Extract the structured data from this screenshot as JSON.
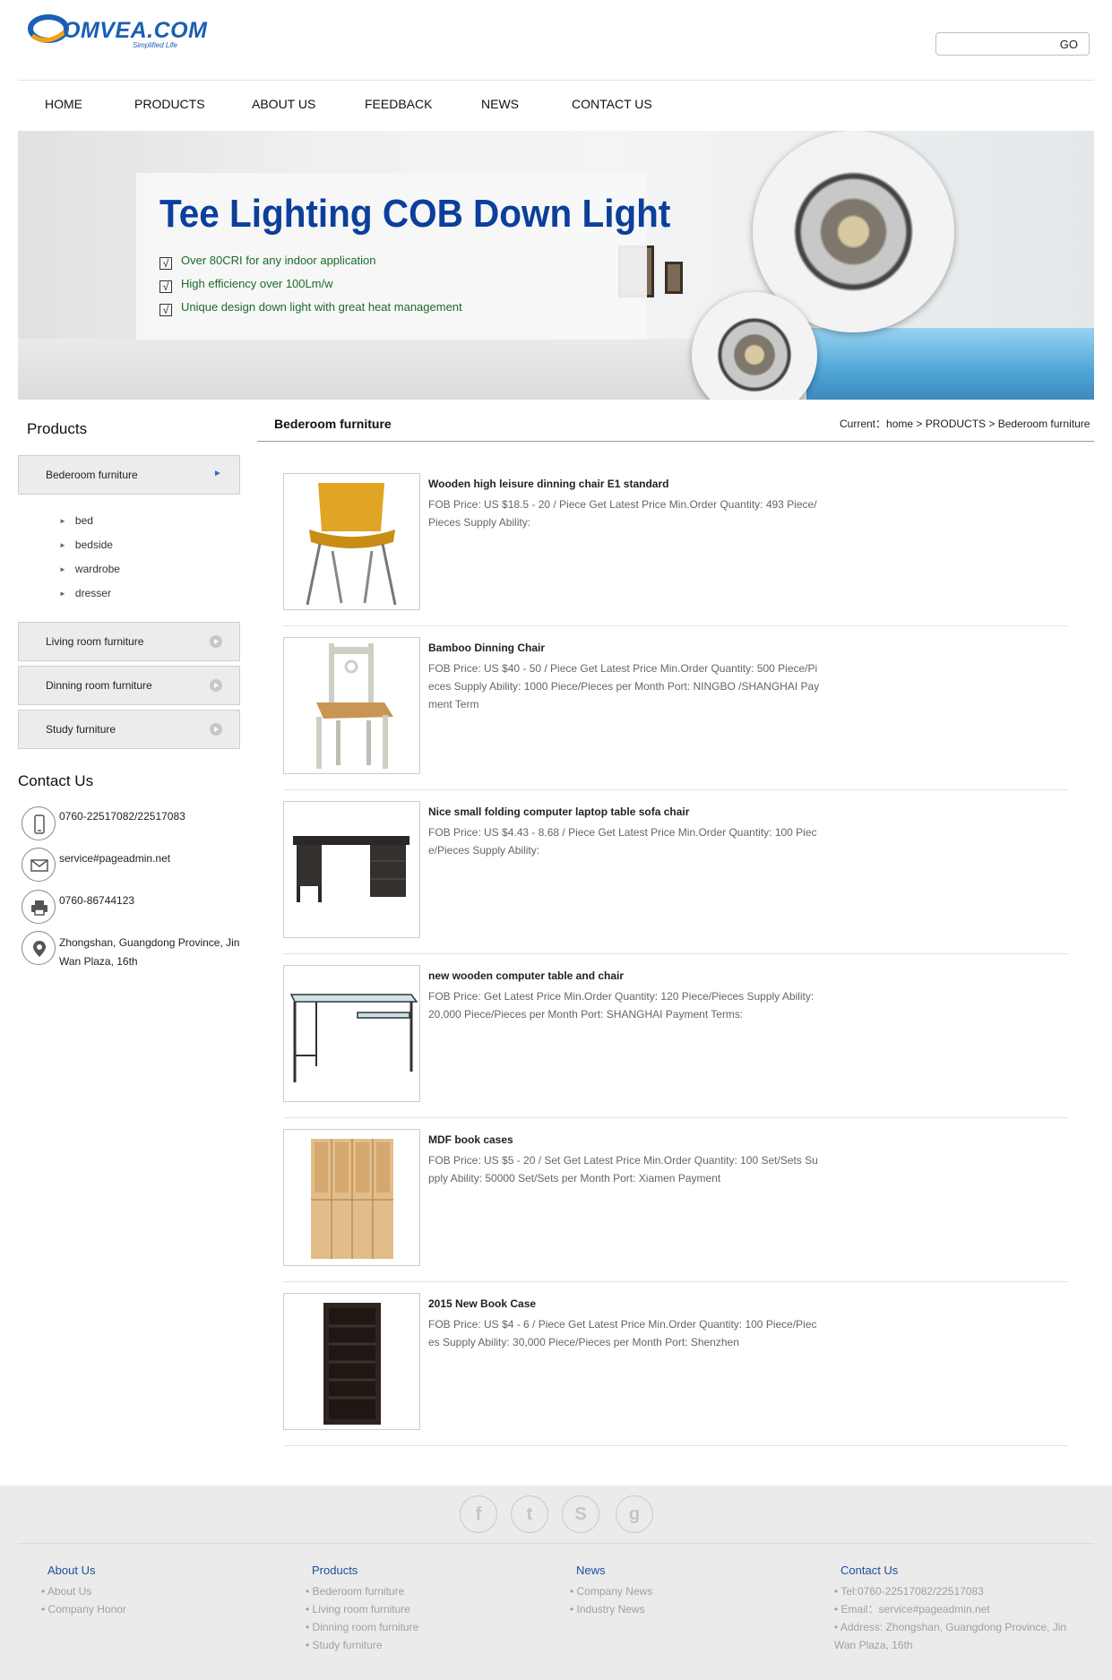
{
  "header": {
    "logo_text": "OMVEA.COM",
    "logo_tagline": "Simplified Life",
    "search_button": "GO",
    "search_value": ""
  },
  "nav": [
    "HOME",
    "PRODUCTS",
    "ABOUT US",
    "FEEDBACK",
    "NEWS",
    "CONTACT US"
  ],
  "banner": {
    "title": "Tee Lighting COB Down Light",
    "bullets": [
      "Over 80CRI for any indoor application",
      "High efficiency over 100Lm/w",
      "Unique design down light with great heat management"
    ]
  },
  "sidebar": {
    "title": "Products",
    "active_category": "Bederoom furniture",
    "subcategories": [
      "bed",
      "bedside",
      "wardrobe",
      "dresser"
    ],
    "categories": [
      "Living room furniture",
      "Dinning room furniture",
      "Study furniture"
    ],
    "contact_title": "Contact Us",
    "contact": {
      "phone": "0760-22517082/22517083",
      "email": "service#pageadmin.net",
      "fax": "0760-86744123",
      "address": "Zhongshan, Guangdong Province, Jin Wan Plaza, 16th"
    }
  },
  "main": {
    "title": "Bederoom furniture",
    "breadcrumb": "Current：home > PRODUCTS > Bederoom furniture",
    "items": [
      {
        "title": "Wooden high leisure dinning chair E1 standard",
        "desc": "FOB Price: US $18.5 - 20 / Piece Get Latest Price Min.Order Quantity: 493 Piece/Pieces Supply Ability:",
        "image": "yellow-chair"
      },
      {
        "title": "Bamboo Dinning Chair",
        "desc": "FOB Price: US $40 - 50 / Piece Get Latest Price Min.Order Quantity: 500 Piece/Pieces Supply Ability: 1000 Piece/Pieces per Month Port: NINGBO /SHANGHAI Payment Term",
        "image": "wooden-chair"
      },
      {
        "title": "Nice small folding computer laptop table sofa chair",
        "desc": "FOB Price: US $4.43 - 8.68 / Piece Get Latest Price Min.Order Quantity: 100 Piece/Pieces Supply Ability:",
        "image": "black-desk"
      },
      {
        "title": "new wooden computer table and chair",
        "desc": "FOB Price: Get Latest Price Min.Order Quantity: 120 Piece/Pieces Supply Ability: 20,000 Piece/Pieces per Month Port: SHANGHAI Payment Terms:",
        "image": "glass-desk"
      },
      {
        "title": "MDF book cases",
        "desc": "FOB Price: US $5 - 20 / Set Get Latest Price Min.Order Quantity: 100 Set/Sets Supply Ability: 50000 Set/Sets per Month Port: Xiamen Payment",
        "image": "bookcase-beige"
      },
      {
        "title": "2015 New Book Case",
        "desc": "FOB Price: US $4 - 6 / Piece Get Latest Price Min.Order Quantity: 100 Piece/Pieces Supply Ability: 30,000 Piece/Pieces per Month Port: Shenzhen",
        "image": "bookcase-dark"
      }
    ]
  },
  "footer": {
    "social": [
      "f",
      "t",
      "S",
      "g"
    ],
    "about": {
      "heading": "About Us",
      "links": [
        "About Us",
        "Company Honor"
      ]
    },
    "products": {
      "heading": "Products",
      "links": [
        "Bederoom furniture",
        "Living room furniture",
        "Dinning room furniture",
        "Study furniture"
      ]
    },
    "news": {
      "heading": "News",
      "links": [
        "Company News",
        "Industry News"
      ]
    },
    "contact": {
      "heading": "Contact Us",
      "links": [
        "Tel:0760-22517082/22517083",
        "Email：service#pageadmin.net",
        "Address: Zhongshan, Guangdong Province, Jin Wan Plaza, 16th"
      ]
    }
  },
  "colors": {
    "brand": "#1a5fb4",
    "banner_title": "#0b3f9c",
    "banner_bullets": "#1d6a2a",
    "footer_bg": "#ebebeb",
    "footer_heading": "#1a4f9e"
  }
}
